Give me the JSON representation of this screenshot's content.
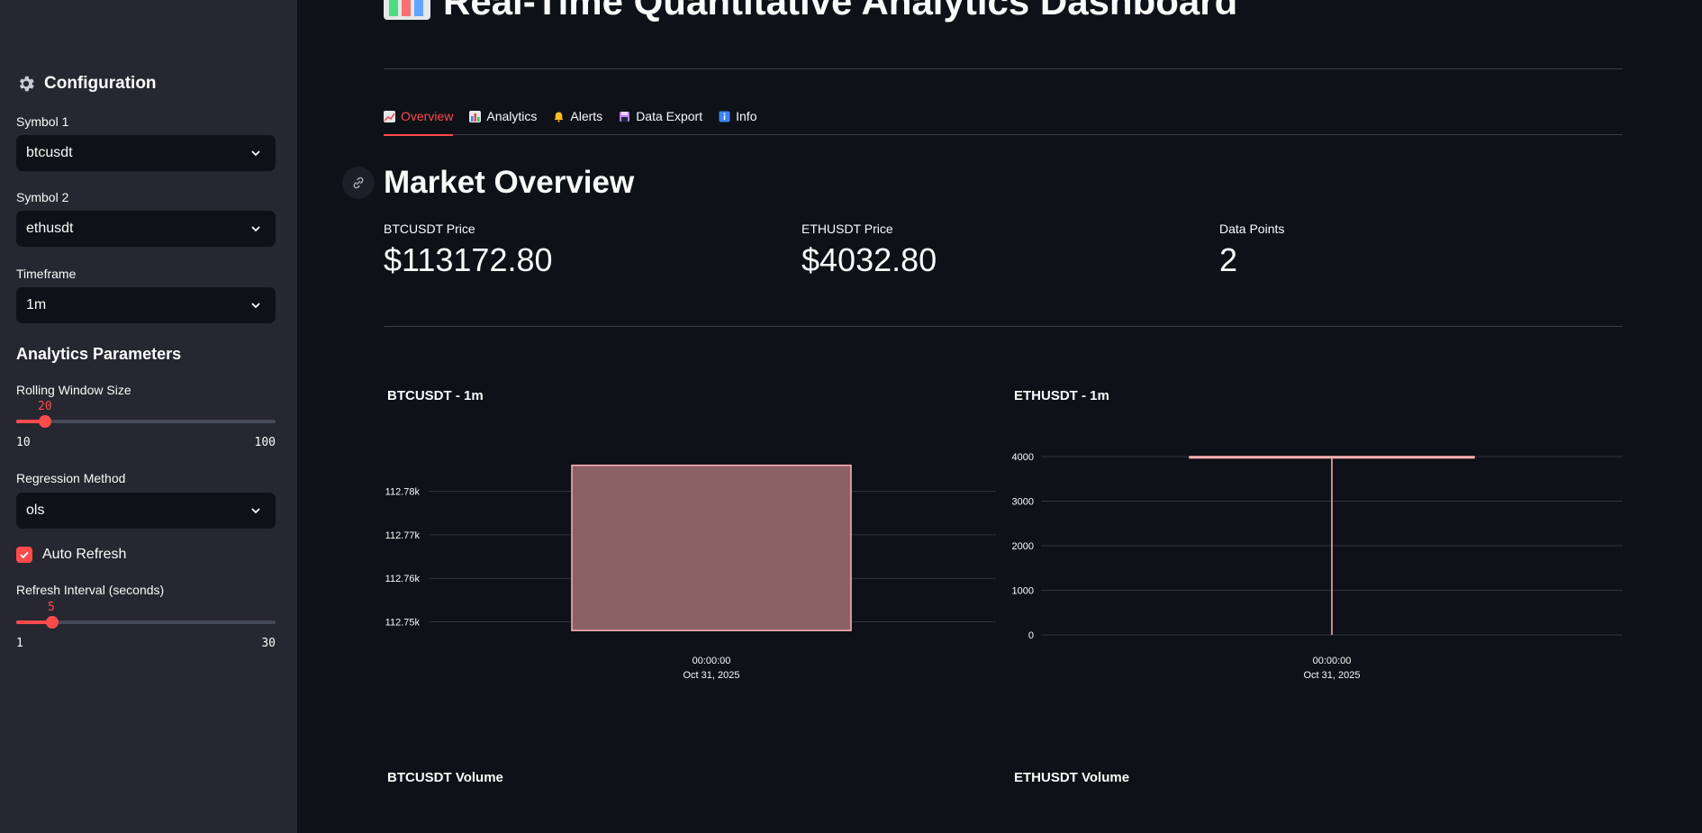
{
  "sidebar": {
    "header": "Configuration",
    "symbol1": {
      "label": "Symbol 1",
      "value": "btcusdt"
    },
    "symbol2": {
      "label": "Symbol 2",
      "value": "ethusdt"
    },
    "timeframe": {
      "label": "Timeframe",
      "value": "1m"
    },
    "analytics_header": "Analytics Parameters",
    "rolling_window": {
      "label": "Rolling Window Size",
      "value": "20",
      "min": "10",
      "max": "100",
      "fraction": 0.1111
    },
    "regression": {
      "label": "Regression Method",
      "value": "ols"
    },
    "auto_refresh": {
      "label": "Auto Refresh",
      "checked": true
    },
    "refresh_interval": {
      "label": "Refresh Interval (seconds)",
      "value": "5",
      "min": "1",
      "max": "30",
      "fraction": 0.1379
    }
  },
  "main": {
    "title": "Real-Time Quantitative Analytics Dashboard",
    "tabs": [
      {
        "label": "Overview",
        "icon": "chart-increasing-icon",
        "active": true
      },
      {
        "label": "Analytics",
        "icon": "bar-chart-icon",
        "active": false
      },
      {
        "label": "Alerts",
        "icon": "bell-icon",
        "active": false
      },
      {
        "label": "Data Export",
        "icon": "floppy-disk-icon",
        "active": false
      },
      {
        "label": "Info",
        "icon": "info-icon",
        "active": false
      }
    ],
    "section_title": "Market Overview",
    "metrics": [
      {
        "label": "BTCUSDT Price",
        "value": "$113172.80"
      },
      {
        "label": "ETHUSDT Price",
        "value": "$4032.80"
      },
      {
        "label": "Data Points",
        "value": "2"
      }
    ],
    "volume_titles": [
      "BTCUSDT Volume",
      "ETHUSDT Volume"
    ]
  },
  "colors": {
    "accent": "#ff4b4b",
    "candle_fill": "#8b6163",
    "candle_stroke": "#ffb3b3"
  },
  "chart_data": [
    {
      "type": "candlestick",
      "title": "BTCUSDT - 1m",
      "x": [
        "00:00:00",
        "Oct 31, 2025"
      ],
      "y_ticks": [
        "112.78k",
        "112.77k",
        "112.76k",
        "112.75k"
      ],
      "y_tick_values": [
        112780,
        112770,
        112760,
        112750
      ],
      "ylim": [
        112747,
        112788
      ],
      "candle": {
        "low": 112748,
        "high": 112786,
        "open_close_low": 112748,
        "open_close_high": 112786
      },
      "grid": true
    },
    {
      "type": "candlestick",
      "title": "ETHUSDT - 1m",
      "x": [
        "00:00:00",
        "Oct 31, 2025"
      ],
      "y_ticks": [
        "4000",
        "3000",
        "2000",
        "1000",
        "0"
      ],
      "y_tick_values": [
        4000,
        3000,
        2000,
        1000,
        0
      ],
      "ylim": [
        0,
        4000
      ],
      "candle": {
        "low": 0,
        "high": 4000,
        "open_close_low": 4000,
        "open_close_high": 4000
      },
      "grid": true
    }
  ]
}
